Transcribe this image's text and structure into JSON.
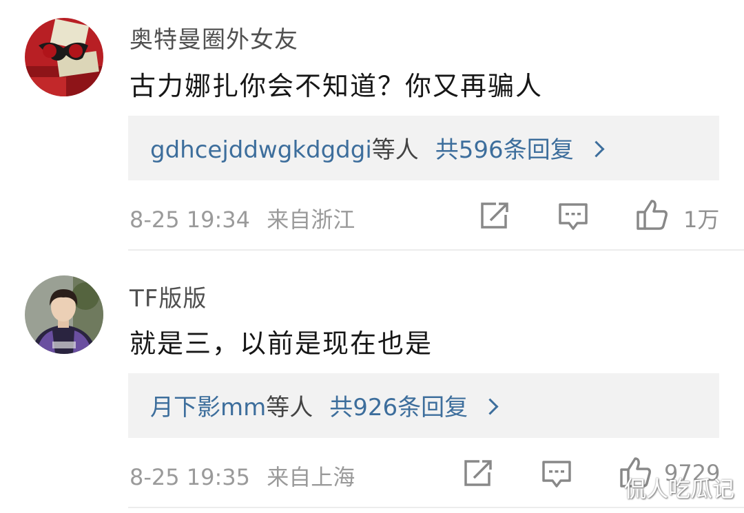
{
  "comments": [
    {
      "username": "奥特曼圈外女友",
      "text": "古力娜扎你会不知道？你又再骗人",
      "replies": {
        "users": "gdhcejddwgkdgdgi",
        "suffix": "等人",
        "count_text": "共596条回复"
      },
      "time": "8-25 19:34",
      "location": "来自浙江",
      "likes": "1万",
      "avatar_colors": {
        "bg": "#c8262a",
        "accent": "#e8e0c8"
      }
    },
    {
      "username": "TF版版",
      "text": "就是三，以前是现在也是",
      "replies": {
        "users": "月下影mm",
        "suffix": "等人",
        "count_text": "共926条回复"
      },
      "time": "8-25 19:35",
      "location": "来自上海",
      "likes": "9729",
      "avatar_colors": {
        "bg": "#8a8f86",
        "accent": "#5b3f8a"
      }
    }
  ],
  "icons": {
    "share": "share-icon",
    "comment": "comment-icon",
    "like": "thumbs-up-icon"
  },
  "colors": {
    "link": "#3d6e9c",
    "meta": "#9a9a9a",
    "reply_bg": "#f2f2f2"
  },
  "watermark": "侃人吃瓜记"
}
